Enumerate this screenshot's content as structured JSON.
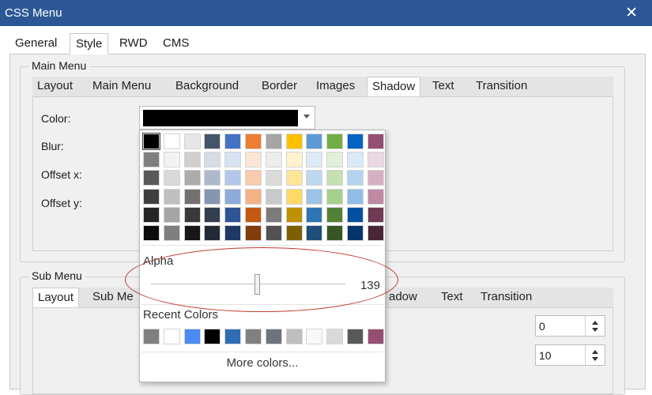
{
  "window": {
    "title": "CSS Menu"
  },
  "top_tabs": [
    "General",
    "Style",
    "RWD",
    "CMS"
  ],
  "main_menu": {
    "label": "Main Menu",
    "tabs": [
      "Layout",
      "Main Menu",
      "Background",
      "Border",
      "Images",
      "Shadow",
      "Text",
      "Transition"
    ],
    "active_tab": "Shadow",
    "fields": {
      "color": "Color:",
      "blur": "Blur:",
      "offset_x": "Offset x:",
      "offset_y": "Offset y:"
    }
  },
  "sub_menu": {
    "label": "Sub Menu",
    "tabs": [
      "Layout",
      "Sub Me",
      "adow",
      "Text",
      "Transition"
    ],
    "active_tab": "Layout",
    "spin1_value": "0",
    "spin2_value": "10"
  },
  "color_picker": {
    "selected_color": "#000000",
    "palette": [
      [
        "#000000",
        "#FFFFFF",
        "#E7E6E6",
        "#44546A",
        "#4472C4",
        "#ED7D31",
        "#A5A5A5",
        "#FFC000",
        "#5B9BD5",
        "#70AD47",
        "#0563C1",
        "#954F72"
      ],
      [
        "#7F7F7F",
        "#F2F2F2",
        "#D0CECE",
        "#D6DCE4",
        "#D9E2F3",
        "#FBE5D5",
        "#EDEDED",
        "#FFF2CC",
        "#DEEBF6",
        "#E2EFD9",
        "#DAE9F7",
        "#EAD7E1"
      ],
      [
        "#595959",
        "#D9D9D9",
        "#AEABAB",
        "#ADB9CA",
        "#B4C6E7",
        "#F7CBAC",
        "#DBDBDB",
        "#FEE599",
        "#BDD7EE",
        "#C5E0B3",
        "#B4D3F0",
        "#D5B0C3"
      ],
      [
        "#3F3F3F",
        "#BFBFBF",
        "#757070",
        "#8496B0",
        "#8EAADB",
        "#F4B183",
        "#C9C9C9",
        "#FFD965",
        "#9CC3E5",
        "#A8D08D",
        "#8FBDE8",
        "#C089A5"
      ],
      [
        "#262626",
        "#A5A5A5",
        "#3A3838",
        "#323F4F",
        "#2F5496",
        "#C45911",
        "#7B7B7B",
        "#BF9000",
        "#2E75B5",
        "#538135",
        "#0450A0",
        "#6F3A55"
      ],
      [
        "#0C0C0C",
        "#7F7F7F",
        "#171616",
        "#222A35",
        "#1F3864",
        "#833C0B",
        "#525252",
        "#7F6000",
        "#1E4E79",
        "#375623",
        "#03356A",
        "#4A2638"
      ]
    ],
    "alpha_label": "Alpha",
    "alpha_value": "139",
    "alpha_fraction": 0.545,
    "recent_label": "Recent Colors",
    "recent_colors": [
      "#7F7F7F",
      "#FFFFFF",
      "#4A8BF5",
      "#000000",
      "#2E6DB4",
      "#808080",
      "#6D7480",
      "#BFBFBF",
      "#F7F9FB",
      "#D9D9D9",
      "#595959",
      "#954F72"
    ],
    "more_colors_label": "More colors..."
  },
  "icons": {
    "close": "close-icon",
    "dropdown": "chevron-down-icon"
  },
  "colors": {
    "titlebar": "#2B5797",
    "annotation": "#C0392B"
  }
}
